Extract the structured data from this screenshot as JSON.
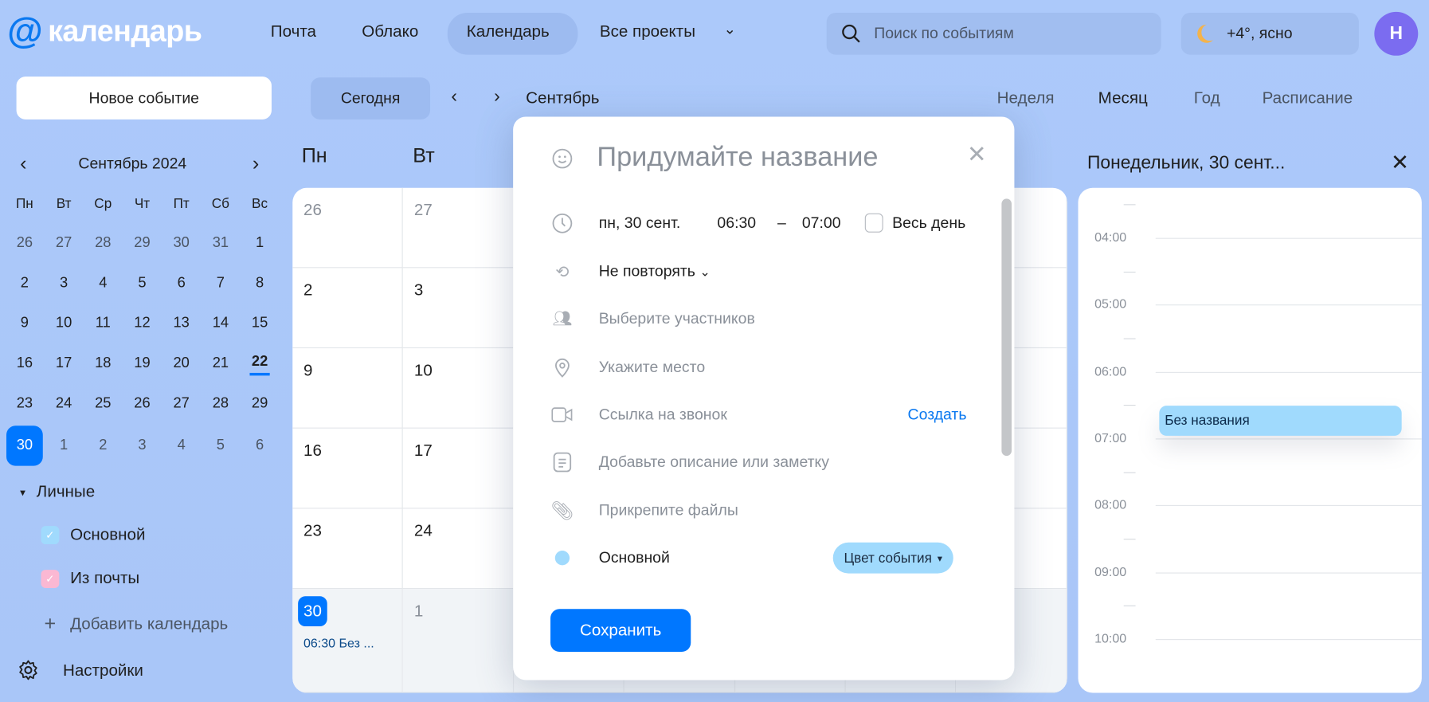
{
  "header": {
    "logo_text": "календарь",
    "nav": [
      "Почта",
      "Облако",
      "Календарь",
      "Все проекты"
    ],
    "search_placeholder": "Поиск по событиям",
    "weather": "+4°, ясно",
    "avatar_letter": "Н"
  },
  "toolbar": {
    "new_event": "Новое событие",
    "today": "Сегодня",
    "month": "Сентябрь",
    "views": [
      "Неделя",
      "Месяц",
      "Год",
      "Расписание"
    ],
    "active_view": "Месяц"
  },
  "mini_calendar": {
    "title": "Сентябрь 2024",
    "weekdays": [
      "Пн",
      "Вт",
      "Ср",
      "Чт",
      "Пт",
      "Сб",
      "Вс"
    ],
    "weeks": [
      [
        "26",
        "27",
        "28",
        "29",
        "30",
        "31",
        "1"
      ],
      [
        "2",
        "3",
        "4",
        "5",
        "6",
        "7",
        "8"
      ],
      [
        "9",
        "10",
        "11",
        "12",
        "13",
        "14",
        "15"
      ],
      [
        "16",
        "17",
        "18",
        "19",
        "20",
        "21",
        "22"
      ],
      [
        "23",
        "24",
        "25",
        "26",
        "27",
        "28",
        "29"
      ],
      [
        "30",
        "1",
        "2",
        "3",
        "4",
        "5",
        "6"
      ]
    ],
    "today": "22",
    "selected": "30"
  },
  "calendars": {
    "group": "Личные",
    "items": [
      {
        "label": "Основной",
        "color": "#a0dafd"
      },
      {
        "label": "Из почты",
        "color": "#fbb8d3"
      }
    ],
    "add": "Добавить календарь",
    "settings": "Настройки"
  },
  "month_grid": {
    "weekdays": [
      "Пн",
      "Вт"
    ],
    "rows": [
      [
        "26",
        "27"
      ],
      [
        "2",
        "3"
      ],
      [
        "9",
        "10"
      ],
      [
        "16",
        "17"
      ],
      [
        "23",
        "24"
      ],
      [
        "30",
        "1"
      ]
    ],
    "event_preview": "06:30 Без ..."
  },
  "popup": {
    "title_placeholder": "Придумайте название",
    "date": "пн, 30 сент.",
    "start": "06:30",
    "dash": "–",
    "end": "07:00",
    "all_day": "Весь день",
    "repeat": "Не повторять",
    "participants": "Выберите участников",
    "place": "Укажите место",
    "call_link": "Ссылка на звонок",
    "call_create": "Создать",
    "description": "Добавьте описание или заметку",
    "attach": "Прикрепите файлы",
    "calendar": "Основной",
    "color_button": "Цвет события",
    "save": "Сохранить"
  },
  "day_panel": {
    "title": "Понедельник, 30 сент...",
    "hours": [
      "04:00",
      "05:00",
      "06:00",
      "07:00",
      "08:00",
      "09:00",
      "10:00"
    ],
    "event": "Без названия"
  },
  "colors": {
    "accent": "#0077ff",
    "event": "#a0dafd",
    "avatar": "#7b6cf0"
  }
}
